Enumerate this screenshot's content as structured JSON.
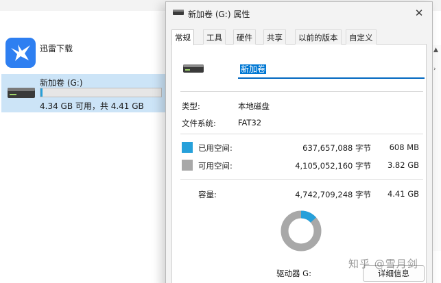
{
  "explorer": {
    "app": {
      "label": "迅雷下载",
      "icon": "thunder-bird-icon"
    },
    "drive": {
      "name": "新加卷 (G:)",
      "free_text": "4.34 GB 可用，共 4.41 GB",
      "used_fraction": 0.016,
      "icon": "drive-icon"
    }
  },
  "dialog": {
    "title": "新加卷 (G:) 属性",
    "close_glyph": "✕",
    "tabs": [
      "常规",
      "工具",
      "硬件",
      "共享",
      "以前的版本",
      "自定义"
    ],
    "active_tab": "常规",
    "general": {
      "name_value": "新加卷",
      "type_label": "类型:",
      "type_value": "本地磁盘",
      "fs_label": "文件系统:",
      "fs_value": "FAT32",
      "used": {
        "label": "已用空间:",
        "bytes": "637,657,088 字节",
        "size": "608 MB",
        "color": "#26a0da"
      },
      "free": {
        "label": "可用空间:",
        "bytes": "4,105,052,160 字节",
        "size": "3.82 GB",
        "color": "#a8a8a8"
      },
      "capacity": {
        "label": "容量:",
        "bytes": "4,742,709,248 字节",
        "size": "4.41 GB"
      },
      "used_fraction": 0.134,
      "drive_label": "驱动器 G:",
      "details_button": "详细信息"
    }
  },
  "watermark": "知乎 @雪月剑"
}
